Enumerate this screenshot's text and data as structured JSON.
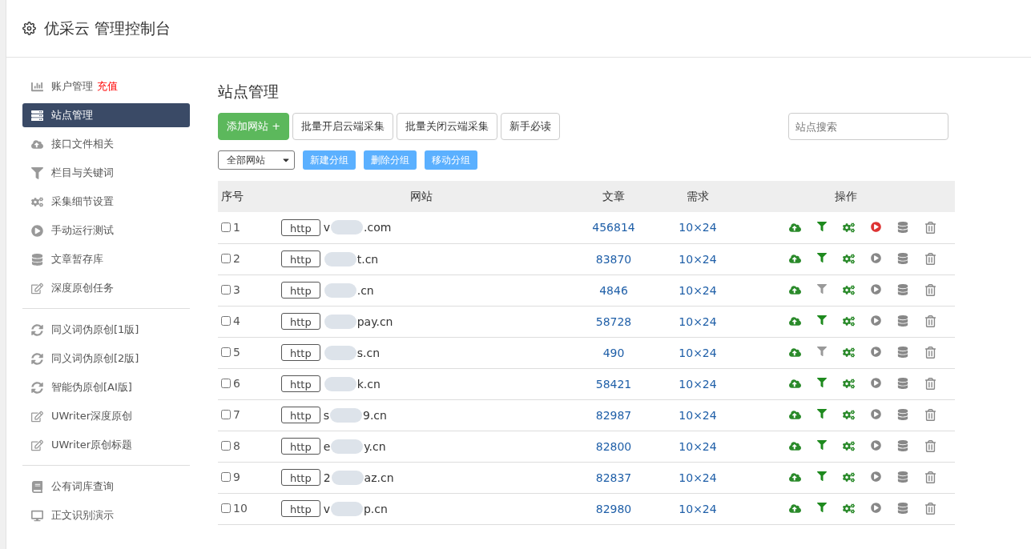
{
  "header": {
    "title": "优采云 管理控制台"
  },
  "sidebar": {
    "groups": [
      {
        "items": [
          {
            "label": "账户管理",
            "badge": "充值",
            "selected": false
          },
          {
            "label": "站点管理",
            "selected": true
          },
          {
            "label": "接口文件相关",
            "selected": false
          },
          {
            "label": "栏目与关键词",
            "selected": false
          },
          {
            "label": "采集细节设置",
            "selected": false
          },
          {
            "label": "手动运行测试",
            "selected": false
          },
          {
            "label": "文章暂存库",
            "selected": false
          },
          {
            "label": "深度原创任务",
            "selected": false
          }
        ]
      },
      {
        "items": [
          {
            "label": "同义词伪原创[1版]",
            "selected": false
          },
          {
            "label": "同义词伪原创[2版]",
            "selected": false
          },
          {
            "label": "智能伪原创[AI版]",
            "selected": false
          },
          {
            "label": "UWriter深度原创",
            "selected": false
          },
          {
            "label": "UWriter原创标题",
            "selected": false
          }
        ]
      },
      {
        "items": [
          {
            "label": "公有词库查询",
            "selected": false
          },
          {
            "label": "正文识别演示",
            "selected": false
          }
        ]
      }
    ]
  },
  "main": {
    "title": "站点管理",
    "toolbar": [
      {
        "label": "添加网站 +",
        "kind": "primary"
      },
      {
        "label": "批量开启云端采集",
        "kind": "default"
      },
      {
        "label": "批量关闭云端采集",
        "kind": "default"
      },
      {
        "label": "新手必读",
        "kind": "default"
      }
    ],
    "search": {
      "placeholder": "站点搜索"
    },
    "group_select": {
      "value": "全部网站"
    },
    "group_buttons": [
      "新建分组",
      "删除分组",
      "移动分组"
    ],
    "table": {
      "columns": [
        "序号",
        "网站",
        "文章",
        "需求",
        "操作"
      ],
      "rows": [
        {
          "index": "1",
          "checked": false,
          "scheme": "http",
          "site_start": "v",
          "site_end": ".com",
          "articles": "456814",
          "demand": "10×24",
          "running": true,
          "filter_on": true
        },
        {
          "index": "2",
          "checked": false,
          "scheme": "http",
          "site_start": "",
          "site_end": "t.cn",
          "articles": "83870",
          "demand": "10×24",
          "running": false,
          "filter_on": true
        },
        {
          "index": "3",
          "checked": false,
          "scheme": "http",
          "site_start": "",
          "site_end": ".cn",
          "articles": "4846",
          "demand": "10×24",
          "running": false,
          "filter_on": false
        },
        {
          "index": "4",
          "checked": false,
          "scheme": "http",
          "site_start": "",
          "site_end": "pay.cn",
          "articles": "58728",
          "demand": "10×24",
          "running": false,
          "filter_on": true
        },
        {
          "index": "5",
          "checked": false,
          "scheme": "http",
          "site_start": "",
          "site_end": "s.cn",
          "articles": "490",
          "demand": "10×24",
          "running": false,
          "filter_on": false
        },
        {
          "index": "6",
          "checked": false,
          "scheme": "http",
          "site_start": "",
          "site_end": "k.cn",
          "articles": "58421",
          "demand": "10×24",
          "running": false,
          "filter_on": true
        },
        {
          "index": "7",
          "checked": false,
          "scheme": "http",
          "site_start": "s",
          "site_end": "9.cn",
          "articles": "82987",
          "demand": "10×24",
          "running": false,
          "filter_on": true
        },
        {
          "index": "8",
          "checked": false,
          "scheme": "http",
          "site_start": "e",
          "site_end": "y.cn",
          "articles": "82800",
          "demand": "10×24",
          "running": false,
          "filter_on": true
        },
        {
          "index": "9",
          "checked": false,
          "scheme": "http",
          "site_start": "2",
          "site_end": "az.cn",
          "articles": "82837",
          "demand": "10×24",
          "running": false,
          "filter_on": true
        },
        {
          "index": "10",
          "checked": false,
          "scheme": "http",
          "site_start": "v",
          "site_end": "p.cn",
          "articles": "82980",
          "demand": "10×24",
          "running": false,
          "filter_on": true
        }
      ]
    }
  }
}
